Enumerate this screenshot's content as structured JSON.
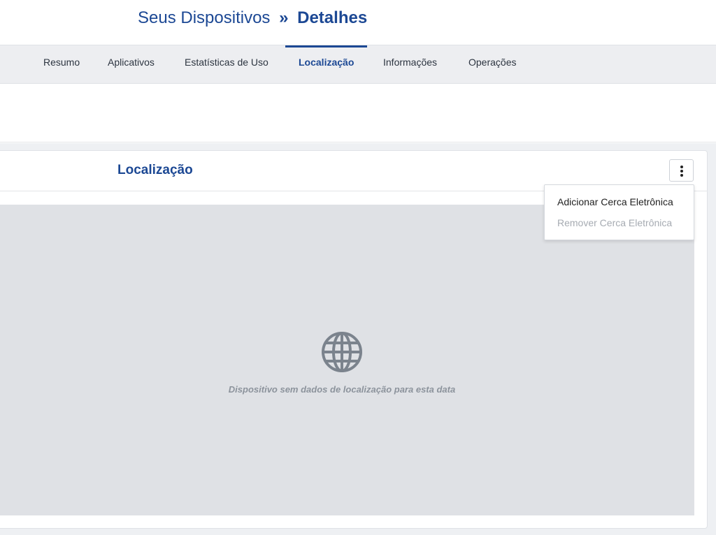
{
  "breadcrumb": {
    "parent": "Seus Dispositivos",
    "separator": "»",
    "current": "Detalhes"
  },
  "tabs": [
    {
      "label": "Resumo",
      "active": false
    },
    {
      "label": "Aplicativos",
      "active": false
    },
    {
      "label": "Estatísticas de Uso",
      "active": false
    },
    {
      "label": "Localização",
      "active": true
    },
    {
      "label": "Informações",
      "active": false
    },
    {
      "label": "Operações",
      "active": false
    }
  ],
  "card": {
    "title": "Localização",
    "menu_icon": "kebab-menu-icon",
    "empty_icon": "globe-icon",
    "empty_message": "Dispositivo sem dados de localização para esta data"
  },
  "dropdown": {
    "items": [
      {
        "label": "Adicionar Cerca Eletrônica",
        "enabled": true
      },
      {
        "label": "Remover Cerca Eletrônica",
        "enabled": false
      }
    ]
  },
  "colors": {
    "brand": "#1c4894",
    "tabbar_bg": "#edeef1",
    "map_bg": "#dfe1e5",
    "globe": "#7b838d",
    "muted_text": "#8c939c",
    "disabled_text": "#a6abb2"
  }
}
